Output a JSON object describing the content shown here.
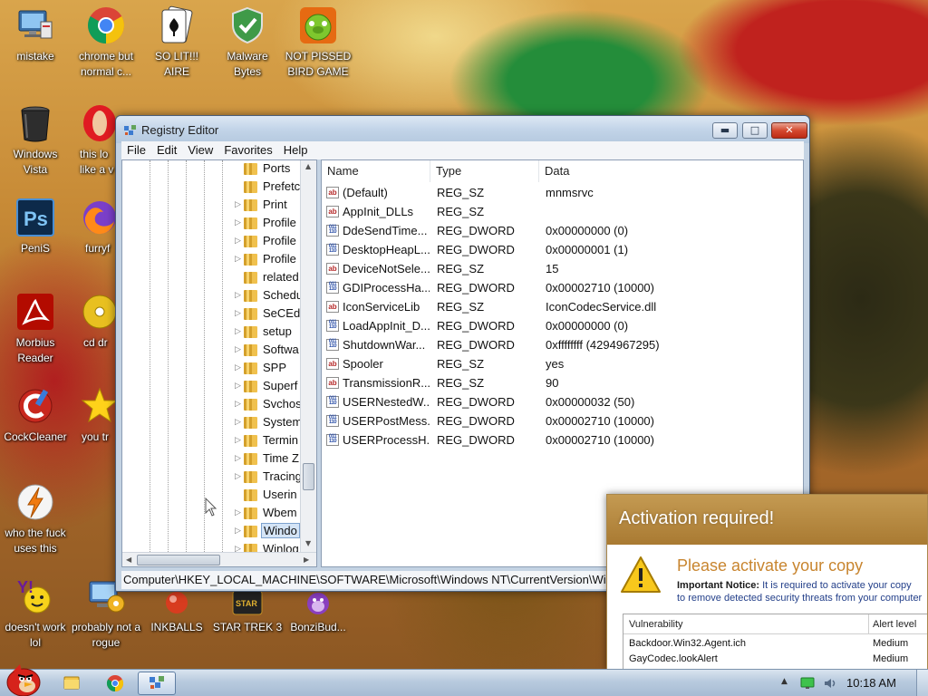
{
  "desktop": {
    "icons": [
      {
        "label": "mistake",
        "icon": "computer-monitor-icon"
      },
      {
        "label": "chrome but normal c...",
        "icon": "chrome-icon"
      },
      {
        "label": "SO LIT!!! AIRE",
        "icon": "playing-card-icon"
      },
      {
        "label": "Malware Bytes",
        "icon": "shield-check-icon"
      },
      {
        "label": "NOT PISSED BIRD GAME",
        "icon": "green-pig-icon"
      },
      {
        "label": "Windows Vista",
        "icon": "trash-bin-icon"
      },
      {
        "label": "this lo like a v",
        "icon": "opera-icon"
      },
      {
        "label": "PeniS",
        "icon": "photoshop-icon"
      },
      {
        "label": "furryf",
        "icon": "firefox-icon"
      },
      {
        "label": "Morbius Reader",
        "icon": "acrobat-icon"
      },
      {
        "label": "cd dr",
        "icon": "cd-drive-icon"
      },
      {
        "label": "CockCleaner",
        "icon": "ccleaner-icon"
      },
      {
        "label": "you tr",
        "icon": "star-icon"
      },
      {
        "label": "who the fuck uses this",
        "icon": "lightning-icon"
      },
      {
        "label": "doesn't work lol",
        "icon": "yahoo-messenger-icon"
      },
      {
        "label": "probably not a rogue",
        "icon": "computer-gear-icon"
      },
      {
        "label": "INKBALLS",
        "icon": "inkball-icon"
      },
      {
        "label": "STAR TREK 3",
        "icon": "star-trek-icon"
      },
      {
        "label": "BonziBud...",
        "icon": "bonzi-icon"
      }
    ]
  },
  "registry_editor": {
    "title": "Registry Editor",
    "icon": "registry-icon",
    "menu": [
      "File",
      "Edit",
      "View",
      "Favorites",
      "Help"
    ],
    "tree": [
      {
        "name": "Ports",
        "expandable": false
      },
      {
        "name": "Prefetc",
        "expandable": false
      },
      {
        "name": "Print",
        "expandable": true
      },
      {
        "name": "Profile",
        "expandable": true
      },
      {
        "name": "Profile",
        "expandable": true
      },
      {
        "name": "Profile",
        "expandable": true
      },
      {
        "name": "related",
        "expandable": false
      },
      {
        "name": "Schedu",
        "expandable": true
      },
      {
        "name": "SeCEd",
        "expandable": true
      },
      {
        "name": "setup",
        "expandable": true
      },
      {
        "name": "Softwa",
        "expandable": true
      },
      {
        "name": "SPP",
        "expandable": true
      },
      {
        "name": "Superf",
        "expandable": true
      },
      {
        "name": "Svchos",
        "expandable": true
      },
      {
        "name": "System",
        "expandable": true
      },
      {
        "name": "Termin",
        "expandable": true
      },
      {
        "name": "Time Z",
        "expandable": true
      },
      {
        "name": "Tracing",
        "expandable": true
      },
      {
        "name": "Userin",
        "expandable": false
      },
      {
        "name": "Wbem",
        "expandable": true
      },
      {
        "name": "Windo",
        "expandable": true,
        "selected": true
      },
      {
        "name": "Winlog",
        "expandable": true
      }
    ],
    "columns": {
      "name": "Name",
      "type": "Type",
      "data": "Data"
    },
    "values": [
      {
        "name": "(Default)",
        "type": "REG_SZ",
        "data": "mnmsrvc",
        "icon": "string-value-icon"
      },
      {
        "name": "AppInit_DLLs",
        "type": "REG_SZ",
        "data": "",
        "icon": "string-value-icon"
      },
      {
        "name": "DdeSendTime...",
        "type": "REG_DWORD",
        "data": "0x00000000 (0)",
        "icon": "binary-value-icon"
      },
      {
        "name": "DesktopHeapL...",
        "type": "REG_DWORD",
        "data": "0x00000001 (1)",
        "icon": "binary-value-icon"
      },
      {
        "name": "DeviceNotSele...",
        "type": "REG_SZ",
        "data": "15",
        "icon": "string-value-icon"
      },
      {
        "name": "GDIProcessHa...",
        "type": "REG_DWORD",
        "data": "0x00002710 (10000)",
        "icon": "binary-value-icon"
      },
      {
        "name": "IconServiceLib",
        "type": "REG_SZ",
        "data": "IconCodecService.dll",
        "icon": "string-value-icon"
      },
      {
        "name": "LoadAppInit_D...",
        "type": "REG_DWORD",
        "data": "0x00000000 (0)",
        "icon": "binary-value-icon"
      },
      {
        "name": "ShutdownWar...",
        "type": "REG_DWORD",
        "data": "0xffffffff (4294967295)",
        "icon": "binary-value-icon"
      },
      {
        "name": "Spooler",
        "type": "REG_SZ",
        "data": "yes",
        "icon": "string-value-icon"
      },
      {
        "name": "TransmissionR...",
        "type": "REG_SZ",
        "data": "90",
        "icon": "string-value-icon"
      },
      {
        "name": "USERNestedW...",
        "type": "REG_DWORD",
        "data": "0x00000032 (50)",
        "icon": "binary-value-icon"
      },
      {
        "name": "USERPostMess...",
        "type": "REG_DWORD",
        "data": "0x00002710 (10000)",
        "icon": "binary-value-icon"
      },
      {
        "name": "USERProcessH...",
        "type": "REG_DWORD",
        "data": "0x00002710 (10000)",
        "icon": "binary-value-icon"
      }
    ],
    "status_path": "Computer\\HKEY_LOCAL_MACHINE\\SOFTWARE\\Microsoft\\Windows NT\\CurrentVersion\\Windows"
  },
  "activation_popup": {
    "title": "Activation required!",
    "heading": "Please activate your copy",
    "notice_bold": "Important Notice:",
    "notice_line1": " It is required to activate your copy",
    "notice_line2": "to remove detected security threats from your computer",
    "columns": {
      "vulnerability": "Vulnerability",
      "alert_level": "Alert level"
    },
    "rows": [
      {
        "vulnerability": "Backdoor.Win32.Agent.ich",
        "alert_level": "Medium"
      },
      {
        "vulnerability": "GayCodec.lookAlert",
        "alert_level": "Medium"
      }
    ]
  },
  "taskbar": {
    "start_icon": "angry-bird-start-icon",
    "pinned": [
      "explorer-icon",
      "chrome-icon",
      "registry-icon"
    ],
    "tray_icons": [
      "show-hidden-icons-arrow",
      "network-icon",
      "volume-icon"
    ],
    "clock": "10:18 AM"
  }
}
